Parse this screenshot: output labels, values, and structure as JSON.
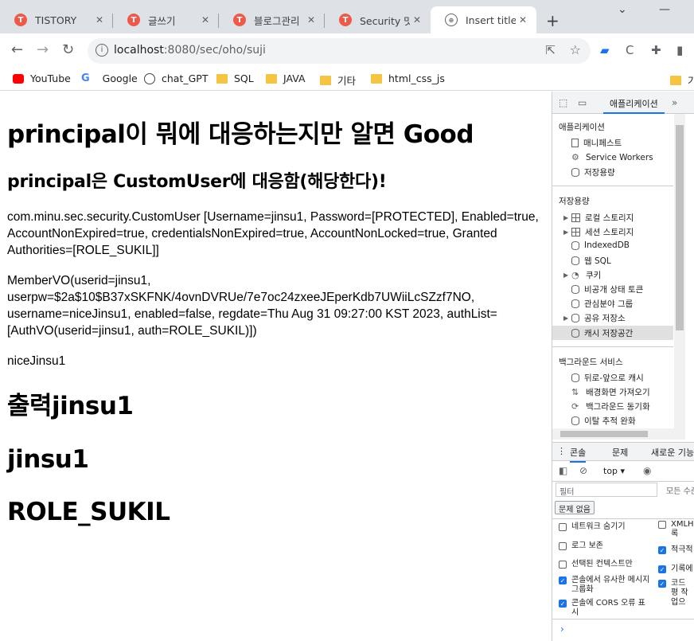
{
  "tabs": [
    {
      "label": "TISTORY",
      "active": false
    },
    {
      "label": "글쓰기",
      "active": false
    },
    {
      "label": "블로그관리 |",
      "active": false
    },
    {
      "label": "Security 맛보",
      "active": false
    },
    {
      "label": "Insert title he",
      "active": true
    }
  ],
  "window": {
    "minimize": "⌄",
    "restore": "—"
  },
  "address": {
    "host": "localhost",
    "path": ":8080/sec/oho/suji"
  },
  "bookmarks": [
    "YouTube",
    "Google",
    "chat_GPT",
    "SQL",
    "JAVA",
    "기타",
    "html_css_js",
    "기"
  ],
  "page": {
    "h1": "principal이 뭐에 대응하는지만 알면 Good",
    "h2": "principal은 CustomUser에 대응함(해당한다)!",
    "p1": "com.minu.sec.security.CustomUser [Username=jinsu1, Password=[PROTECTED], Enabled=true, AccountNonExpired=true, credentialsNonExpired=true, AccountNonLocked=true, Granted Authorities=[ROLE_SUKIL]]",
    "p2": "MemberVO(userid=jinsu1, userpw=$2a$10$B37xSKFNK/4ovnDVRUe/7e7oc24zxeeJEperKdb7UWiiLcSZzf7NO, username=niceJinsu1, enabled=false, regdate=Thu Aug 31 09:27:00 KST 2023, authList=[AuthVO(userid=jinsu1, auth=ROLE_SUKIL)])",
    "p3": "niceJinsu1",
    "h1b": "출력jinsu1",
    "h1c": "jinsu1",
    "h1d": "ROLE_SUKIL"
  },
  "devtools": {
    "active_tab": "애플리케이션",
    "more": "»",
    "sections": {
      "app": {
        "title": "애플리케이션",
        "items": [
          "매니페스트",
          "Service Workers",
          "저장용량"
        ]
      },
      "storage": {
        "title": "저장용량",
        "items": [
          "로컬 스토리지",
          "세션 스토리지",
          "IndexedDB",
          "웹 SQL",
          "쿠키",
          "비공개 상태 토큰",
          "관심분야 그룹",
          "공유 저장소",
          "캐시 저장공간"
        ]
      },
      "bg": {
        "title": "백그라운드 서비스",
        "items": [
          "뒤로-앞으로 캐시",
          "배경화면 가져오기",
          "백그라운드 동기화",
          "이탈 추적 완화"
        ]
      }
    },
    "drawer_tabs": [
      "콘솔",
      "문제",
      "새로운 기능"
    ],
    "context": "top",
    "filter_placeholder": "필터",
    "levels": "모든 수준",
    "no_issues": "문제 없음",
    "settings_left": [
      {
        "label": "네트워크 숨기기",
        "checked": false
      },
      {
        "label": "로그 보존",
        "checked": false
      },
      {
        "label": "선택된 컨텍스트만",
        "checked": false
      },
      {
        "label": "콘솔에서 유사한 메시지 그룹화",
        "checked": true
      },
      {
        "label": "콘솔에 CORS 오류 표시",
        "checked": true
      }
    ],
    "settings_right": [
      {
        "label": "XMLH 록",
        "checked": false
      },
      {
        "label": "적극적",
        "checked": true
      },
      {
        "label": "기록에",
        "checked": true
      },
      {
        "label": "코드 평 작업으",
        "checked": true
      }
    ],
    "prompt": "›"
  }
}
